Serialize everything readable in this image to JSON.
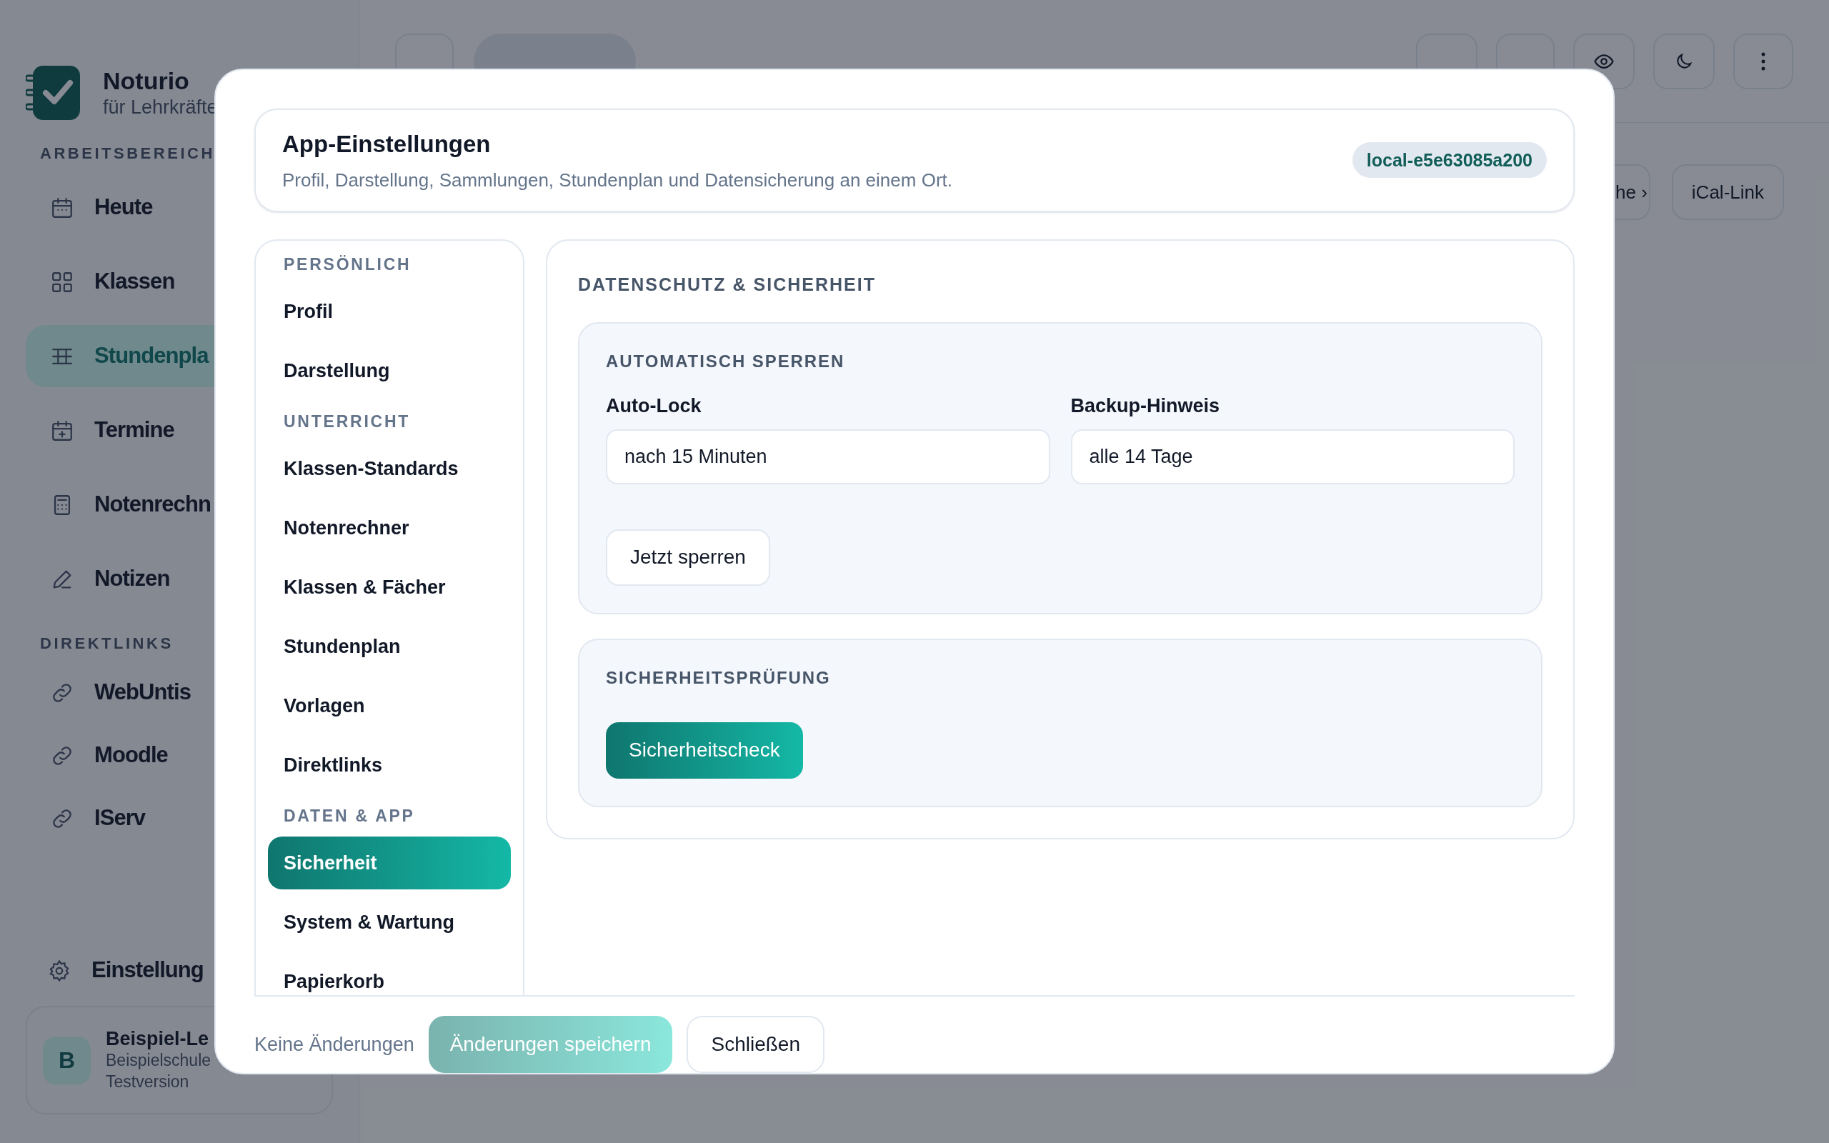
{
  "app": {
    "brand": {
      "name": "Noturio",
      "tagline": "für Lehrkräfte"
    },
    "sidebar": {
      "sections": [
        {
          "heading": "ARBEITSBEREICH",
          "items": [
            {
              "label": "Heute",
              "selected": false
            },
            {
              "label": "Klassen",
              "selected": false
            },
            {
              "label": "Stundenpla",
              "selected": true
            },
            {
              "label": "Termine",
              "selected": false
            },
            {
              "label": "Notenrechn",
              "selected": false
            },
            {
              "label": "Notizen",
              "selected": false
            }
          ]
        },
        {
          "heading": "DIREKTLINKS",
          "items": [
            {
              "label": "WebUntis",
              "selected": false
            },
            {
              "label": "Moodle",
              "selected": false
            },
            {
              "label": "IServ",
              "selected": false
            }
          ]
        }
      ],
      "settings": {
        "label": "Einstellung"
      },
      "user": {
        "initial": "B",
        "name": "Beispiel-Le",
        "school": "Beispielschule",
        "plan": "Testversion"
      }
    },
    "toolbar": {
      "buttons": [
        "he ›",
        "iCal-Link"
      ]
    }
  },
  "dialog": {
    "title": "App-Einstellungen",
    "subtitle": "Profil, Darstellung, Sammlungen, Stundenplan und Datensicherung an einem Ort.",
    "badge": "local-e5e63085a200",
    "nav": [
      {
        "heading": "PERSÖNLICH",
        "items": [
          {
            "label": "Profil",
            "selected": false
          },
          {
            "label": "Darstellung",
            "selected": false
          }
        ]
      },
      {
        "heading": "UNTERRICHT",
        "items": [
          {
            "label": "Klassen-Standards",
            "selected": false
          },
          {
            "label": "Notenrechner",
            "selected": false
          },
          {
            "label": "Klassen & Fächer",
            "selected": false
          },
          {
            "label": "Stundenplan",
            "selected": false
          },
          {
            "label": "Vorlagen",
            "selected": false
          },
          {
            "label": "Direktlinks",
            "selected": false
          }
        ]
      },
      {
        "heading": "DATEN & APP",
        "items": [
          {
            "label": "Sicherheit",
            "selected": true
          },
          {
            "label": "System & Wartung",
            "selected": false
          },
          {
            "label": "Papierkorb",
            "selected": false
          }
        ]
      }
    ],
    "panel": {
      "title": "DATENSCHUTZ & SICHERHEIT",
      "cards": [
        {
          "heading": "AUTOMATISCH SPERREN",
          "fields": [
            {
              "label": "Auto-Lock",
              "value": "nach 15 Minuten"
            },
            {
              "label": "Backup-Hinweis",
              "value": "alle 14 Tage"
            }
          ],
          "buttons": [
            {
              "label": "Jetzt sperren",
              "kind": "secondary"
            }
          ]
        },
        {
          "heading": "SICHERHEITSPRÜFUNG",
          "buttons": [
            {
              "label": "Sicherheitscheck",
              "kind": "primary"
            }
          ]
        }
      ]
    },
    "footer": {
      "status": "Keine Änderungen",
      "save": {
        "label": "Änderungen speichern",
        "disabled": true
      },
      "close": {
        "label": "Schließen"
      }
    }
  }
}
